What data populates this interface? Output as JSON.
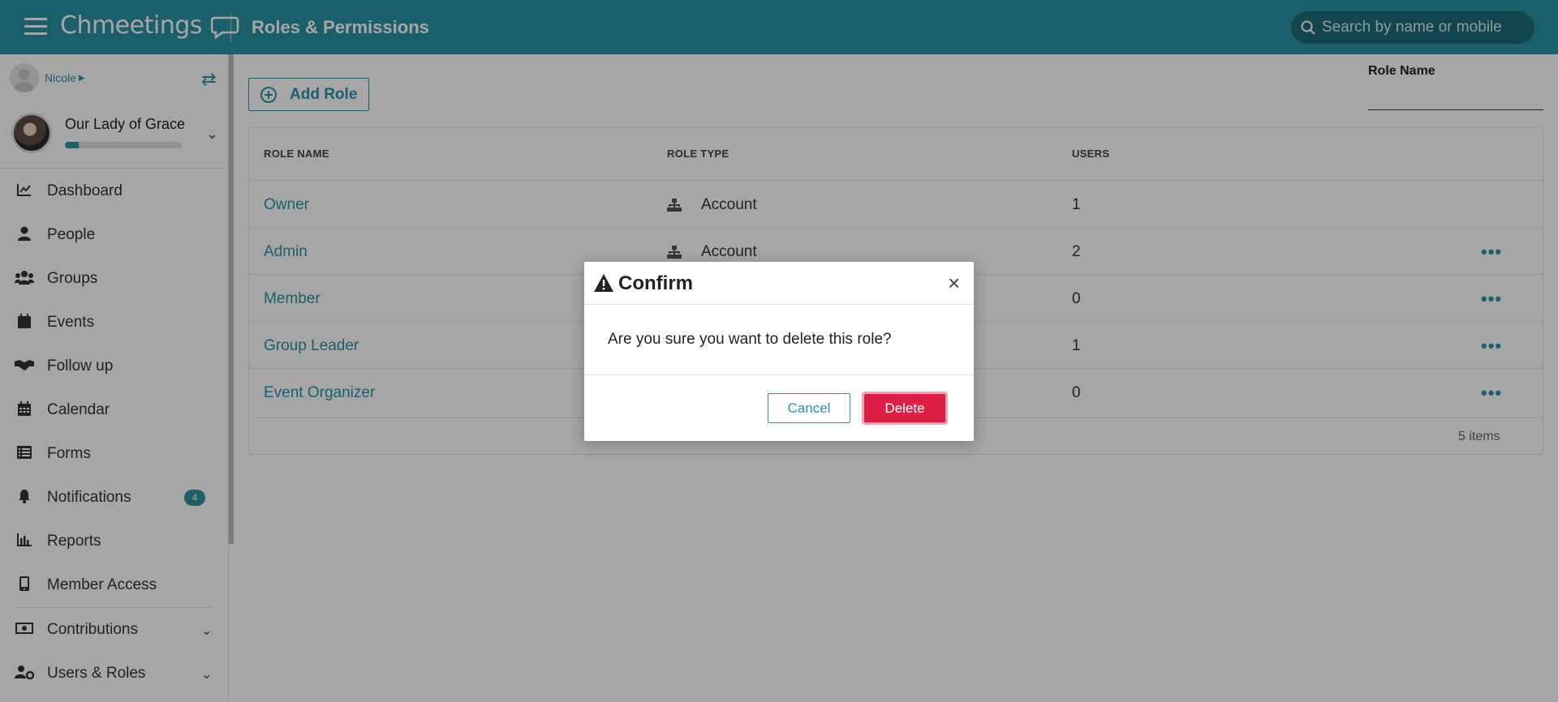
{
  "header": {
    "logo_text": "Chmeetings",
    "page_title": "Roles & Permissions",
    "search_placeholder": "Search by name or mobile"
  },
  "sidebar": {
    "user_name": "Nicole",
    "church_name": "Our Lady of Grace",
    "church_progress_percent": 12,
    "items": [
      {
        "label": "Dashboard",
        "icon": "chart-line-icon"
      },
      {
        "label": "People",
        "icon": "person-icon"
      },
      {
        "label": "Groups",
        "icon": "users-icon"
      },
      {
        "label": "Events",
        "icon": "calendar-icon"
      },
      {
        "label": "Follow up",
        "icon": "handshake-icon"
      },
      {
        "label": "Calendar",
        "icon": "calendar-grid-icon"
      },
      {
        "label": "Forms",
        "icon": "list-icon"
      },
      {
        "label": "Notifications",
        "icon": "bell-icon",
        "badge": "4"
      },
      {
        "label": "Reports",
        "icon": "bar-chart-icon"
      },
      {
        "label": "Member Access",
        "icon": "mobile-icon"
      },
      {
        "label": "Contributions",
        "icon": "money-icon"
      },
      {
        "label": "Users & Roles",
        "icon": "users-cog-icon"
      }
    ]
  },
  "main": {
    "add_role_label": "Add Role",
    "filter_label": "Role Name",
    "table": {
      "headers": [
        "ROLE NAME",
        "ROLE TYPE",
        "USERS"
      ],
      "rows": [
        {
          "name": "Owner",
          "type": "Account",
          "users": "1"
        },
        {
          "name": "Admin",
          "type": "Account",
          "users": "2"
        },
        {
          "name": "Member",
          "type": "",
          "users": "0"
        },
        {
          "name": "Group Leader",
          "type": "",
          "users": "1"
        },
        {
          "name": "Event Organizer",
          "type": "",
          "users": "0"
        }
      ],
      "items_count": "5 items"
    }
  },
  "modal": {
    "title": "Confirm",
    "message": "Are you sure you want to delete this role?",
    "cancel_label": "Cancel",
    "delete_label": "Delete",
    "close_symbol": "×"
  },
  "colors": {
    "accent": "#2a93a4",
    "danger": "#dc1f45"
  }
}
